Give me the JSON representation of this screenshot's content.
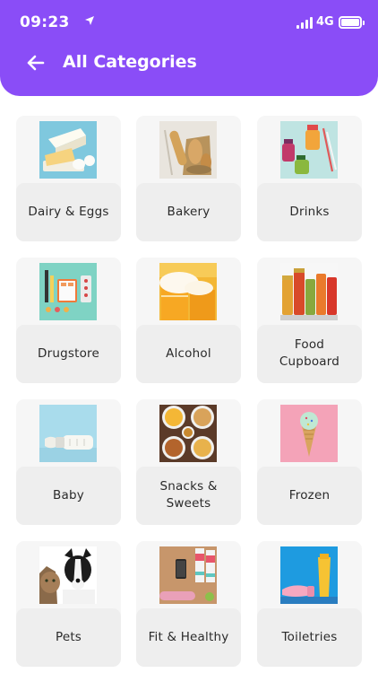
{
  "status_bar": {
    "time": "09:23",
    "network": "4G"
  },
  "header": {
    "title": "All Categories",
    "accent_color": "#8a4df7"
  },
  "categories": [
    {
      "label": "Dairy & Eggs",
      "icon": "dairy-eggs-image"
    },
    {
      "label": "Bakery",
      "icon": "bakery-image"
    },
    {
      "label": "Drinks",
      "icon": "drinks-image"
    },
    {
      "label": "Drugstore",
      "icon": "drugstore-image"
    },
    {
      "label": "Alcohol",
      "icon": "alcohol-image"
    },
    {
      "label": "Food Cupboard",
      "icon": "food-cupboard-image"
    },
    {
      "label": "Baby",
      "icon": "baby-image"
    },
    {
      "label": "Snacks & Sweets",
      "icon": "snacks-sweets-image"
    },
    {
      "label": "Frozen",
      "icon": "frozen-image"
    },
    {
      "label": "Pets",
      "icon": "pets-image"
    },
    {
      "label": "Fit & Healthy",
      "icon": "fit-healthy-image"
    },
    {
      "label": "Toiletries",
      "icon": "toiletries-image"
    }
  ]
}
